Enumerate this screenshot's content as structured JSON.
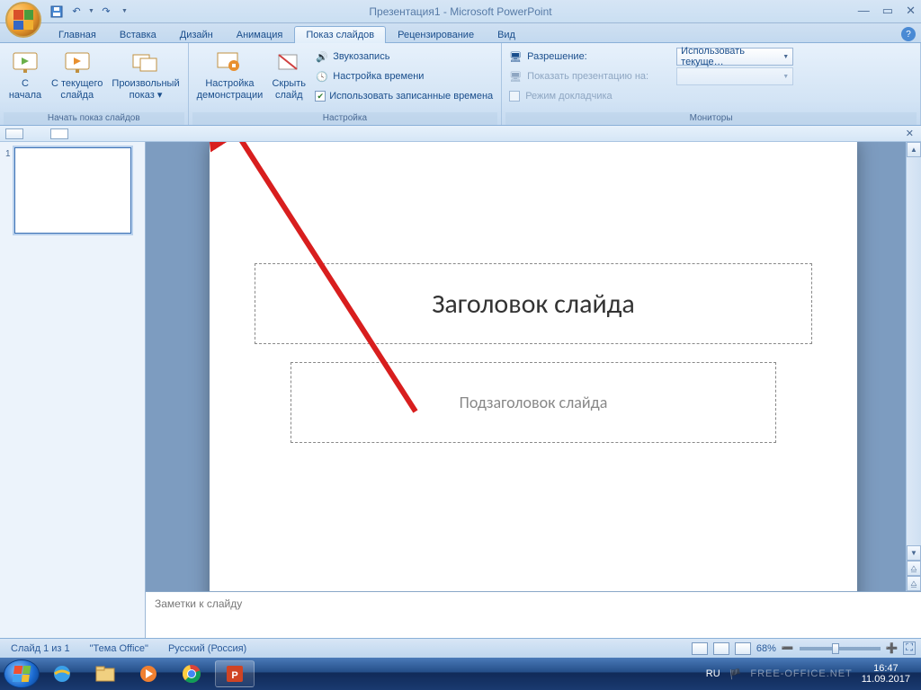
{
  "title": "Презентация1 - Microsoft PowerPoint",
  "qat": {
    "save": "💾",
    "undo": "↶",
    "redo": "↷"
  },
  "tabs": [
    "Главная",
    "Вставка",
    "Дизайн",
    "Анимация",
    "Показ слайдов",
    "Рецензирование",
    "Вид"
  ],
  "activeTab": 4,
  "ribbon": {
    "group1": {
      "label": "Начать показ слайдов",
      "btn1": {
        "l1": "С",
        "l2": "начала"
      },
      "btn2": {
        "l1": "С текущего",
        "l2": "слайда"
      },
      "btn3": {
        "l1": "Произвольный",
        "l2": "показ ▾"
      }
    },
    "group2": {
      "label": "Настройка",
      "btn1": {
        "l1": "Настройка",
        "l2": "демонстрации"
      },
      "btn2": {
        "l1": "Скрыть",
        "l2": "слайд"
      },
      "r1": "Звукозапись",
      "r2": "Настройка времени",
      "r3": "Использовать записанные времена"
    },
    "group3": {
      "label": "Мониторы",
      "row1": "Разрешение:",
      "row2": "Показать презентацию на:",
      "row3": "Режим докладчика",
      "select": "Использовать текуще…"
    }
  },
  "slide": {
    "title": "Заголовок слайда",
    "subtitle": "Подзаголовок слайда"
  },
  "notes": "Заметки к слайду",
  "status": {
    "slide": "Слайд 1 из 1",
    "theme": "\"Тема Office\"",
    "lang": "Русский (Россия)",
    "zoom": "68%"
  },
  "tray": {
    "lang": "RU",
    "time": "16:47",
    "date": "11.09.2017"
  },
  "watermark": "FREE-OFFICE.NET",
  "thumbNum": "1"
}
